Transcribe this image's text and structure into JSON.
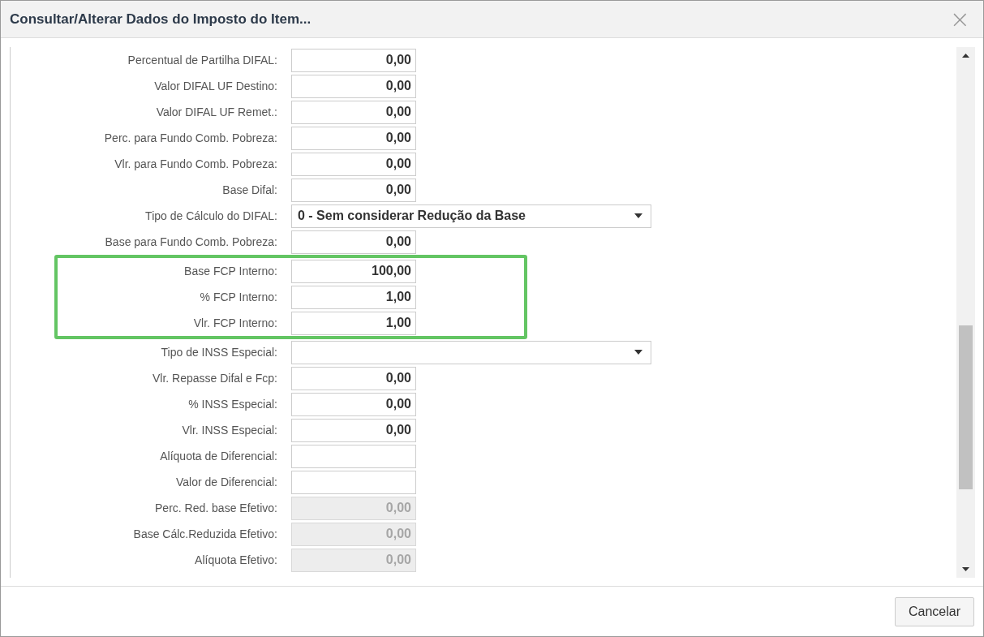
{
  "dialog": {
    "title": "Consultar/Alterar Dados do Imposto do Item...",
    "close_symbol": "×"
  },
  "sections": [
    {
      "highlighted": false,
      "fields": [
        {
          "label": "Percentual de Partilha DIFAL:",
          "kind": "number",
          "value": "0,00",
          "disabled": false
        },
        {
          "label": "Valor DIFAL UF Destino:",
          "kind": "number",
          "value": "0,00",
          "disabled": false
        },
        {
          "label": "Valor DIFAL UF Remet.:",
          "kind": "number",
          "value": "0,00",
          "disabled": false
        },
        {
          "label": "Perc. para Fundo Comb. Pobreza:",
          "kind": "number",
          "value": "0,00",
          "disabled": false
        },
        {
          "label": "Vlr. para Fundo Comb. Pobreza:",
          "kind": "number",
          "value": "0,00",
          "disabled": false
        },
        {
          "label": "Base Difal:",
          "kind": "number",
          "value": "0,00",
          "disabled": false
        },
        {
          "label": "Tipo de Cálculo do DIFAL:",
          "kind": "select",
          "value": "0 - Sem considerar Redução da Base"
        },
        {
          "label": "Base para Fundo Comb. Pobreza:",
          "kind": "number",
          "value": "0,00",
          "disabled": false
        }
      ]
    },
    {
      "highlighted": true,
      "fields": [
        {
          "label": "Base FCP Interno:",
          "kind": "number",
          "value": "100,00",
          "disabled": false
        },
        {
          "label": "% FCP Interno:",
          "kind": "number",
          "value": "1,00",
          "disabled": false
        },
        {
          "label": "Vlr. FCP Interno:",
          "kind": "number",
          "value": "1,00",
          "disabled": false
        }
      ]
    },
    {
      "highlighted": false,
      "fields": [
        {
          "label": "Tipo de INSS Especial:",
          "kind": "select"
        },
        {
          "label": "Vlr. Repasse Difal e Fcp:",
          "kind": "number",
          "value": "0,00",
          "disabled": false
        },
        {
          "label": "% INSS Especial:",
          "kind": "number",
          "value": "0,00",
          "disabled": false
        },
        {
          "label": "Vlr. INSS Especial:",
          "kind": "number",
          "value": "0,00",
          "disabled": false
        },
        {
          "label": "Alíquota de Diferencial:",
          "kind": "number",
          "disabled": false
        },
        {
          "label": "Valor de Diferencial:",
          "kind": "number",
          "disabled": false
        },
        {
          "label": "Perc. Red. base Efetivo:",
          "kind": "number",
          "value": "0,00",
          "disabled": true
        },
        {
          "label": "Base Cálc.Reduzida Efetivo:",
          "kind": "number",
          "value": "0,00",
          "disabled": true
        },
        {
          "label": "Alíquota Efetivo:",
          "kind": "number",
          "value": "0,00",
          "disabled": true
        }
      ]
    }
  ],
  "buttons": [
    {
      "label": "Cancelar"
    }
  ]
}
